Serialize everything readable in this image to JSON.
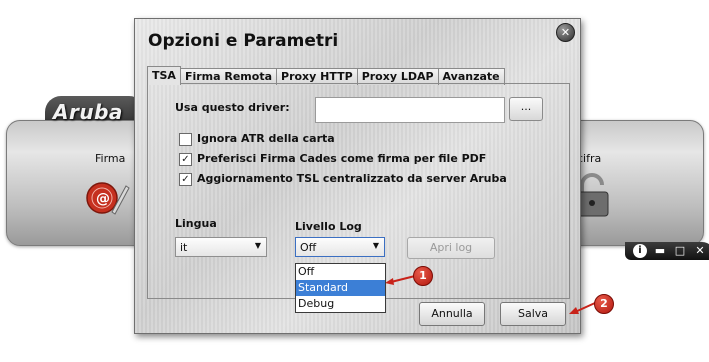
{
  "background_app": {
    "logo": "Aruba",
    "tool_left_label": "Firma",
    "tool_right_label": "cifra",
    "controls": [
      "i",
      "▬",
      "□",
      "✕"
    ]
  },
  "dialog": {
    "title": "Opzioni e Parametri",
    "close_glyph": "✕",
    "tabs": [
      {
        "label": "TSA",
        "active": true
      },
      {
        "label": "Firma Remota",
        "active": false
      },
      {
        "label": "Proxy HTTP",
        "active": false
      },
      {
        "label": "Proxy LDAP",
        "active": false
      },
      {
        "label": "Avanzate",
        "active": false
      }
    ],
    "driver": {
      "label": "Usa questo driver:",
      "value": "",
      "browse_label": "..."
    },
    "checkboxes": [
      {
        "label": "Ignora ATR della carta",
        "checked": false
      },
      {
        "label": "Preferisci Firma Cades come firma per file PDF",
        "checked": true
      },
      {
        "label": "Aggiornamento TSL centralizzato da server Aruba",
        "checked": true
      }
    ],
    "language": {
      "label": "Lingua",
      "value": "it"
    },
    "log_level": {
      "label": "Livello Log",
      "value": "Off",
      "options": [
        "Off",
        "Standard",
        "Debug"
      ],
      "highlighted": "Standard"
    },
    "open_log_label": "Apri log",
    "cancel_label": "Annulla",
    "save_label": "Salva"
  },
  "callouts": [
    "1",
    "2"
  ],
  "colors": {
    "callout": "#c8231a",
    "selection": "#3c7fd6"
  }
}
